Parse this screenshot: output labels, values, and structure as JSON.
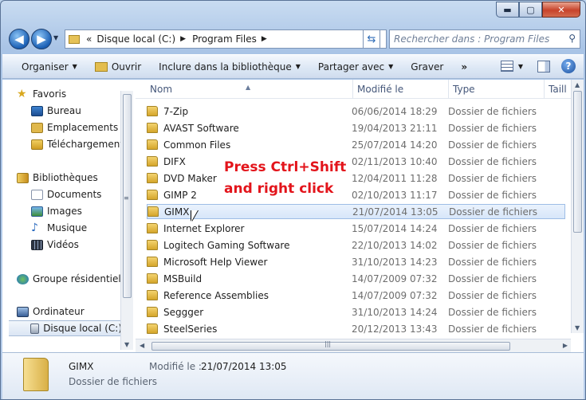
{
  "window": {
    "min": "▬",
    "max": "▢",
    "close": "✕"
  },
  "address": {
    "chevron": "«",
    "segments": [
      "Disque local (C:)",
      "Program Files"
    ]
  },
  "search": {
    "placeholder": "Rechercher dans : Program Files"
  },
  "toolbar": {
    "organize": "Organiser",
    "open": "Ouvrir",
    "include": "Inclure dans la bibliothèque",
    "share": "Partager avec",
    "burn": "Graver",
    "more": "»"
  },
  "nav": {
    "favorites": "Favoris",
    "desktop": "Bureau",
    "places": "Emplacements ré",
    "downloads": "Téléchargements",
    "libraries": "Bibliothèques",
    "documents": "Documents",
    "images": "Images",
    "music": "Musique",
    "videos": "Vidéos",
    "homegroup": "Groupe résidentiel",
    "computer": "Ordinateur",
    "localdisk": "Disque local (C:)"
  },
  "columns": {
    "name": "Nom",
    "modified": "Modifié le",
    "type": "Type",
    "size": "Taill"
  },
  "files": [
    {
      "name": "7-Zip",
      "date": "06/06/2014 18:29",
      "type": "Dossier de fichiers"
    },
    {
      "name": "AVAST Software",
      "date": "19/04/2013 21:11",
      "type": "Dossier de fichiers"
    },
    {
      "name": "Common Files",
      "date": "25/07/2014 14:20",
      "type": "Dossier de fichiers"
    },
    {
      "name": "DIFX",
      "date": "02/11/2013 10:40",
      "type": "Dossier de fichiers"
    },
    {
      "name": "DVD Maker",
      "date": "12/04/2011 11:28",
      "type": "Dossier de fichiers"
    },
    {
      "name": "GIMP 2",
      "date": "02/10/2013 11:17",
      "type": "Dossier de fichiers"
    },
    {
      "name": "GIMX",
      "date": "21/07/2014 13:05",
      "type": "Dossier de fichiers"
    },
    {
      "name": "Internet Explorer",
      "date": "15/07/2014 14:24",
      "type": "Dossier de fichiers"
    },
    {
      "name": "Logitech Gaming Software",
      "date": "22/10/2013 14:02",
      "type": "Dossier de fichiers"
    },
    {
      "name": "Microsoft Help Viewer",
      "date": "31/10/2013 14:23",
      "type": "Dossier de fichiers"
    },
    {
      "name": "MSBuild",
      "date": "14/07/2009 07:32",
      "type": "Dossier de fichiers"
    },
    {
      "name": "Reference Assemblies",
      "date": "14/07/2009 07:32",
      "type": "Dossier de fichiers"
    },
    {
      "name": "Seggger",
      "date": "31/10/2013 14:24",
      "type": "Dossier de fichiers"
    },
    {
      "name": "SteelSeries",
      "date": "20/12/2013 13:43",
      "type": "Dossier de fichiers"
    }
  ],
  "overlay": {
    "line1": "Press Ctrl+Shift",
    "line2": "and right click"
  },
  "details": {
    "name": "GIMX",
    "type": "Dossier de fichiers",
    "modified_label": "Modifié le :",
    "modified_value": "21/07/2014 13:05"
  }
}
